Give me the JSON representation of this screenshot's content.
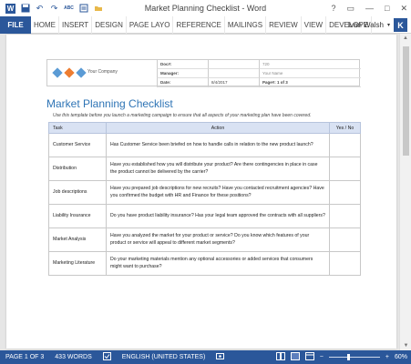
{
  "window": {
    "title": "Market Planning Checklist - Word",
    "controls": [
      "?",
      "▭",
      "—",
      "□",
      "✕"
    ]
  },
  "qat": {
    "icons": [
      "word-icon",
      "save-icon",
      "undo-icon",
      "redo-icon",
      "spelling-icon",
      "print-preview-icon",
      "open-icon"
    ],
    "spelling_label": "ABC"
  },
  "ribbon": {
    "file_label": "FILE",
    "tabs": [
      "HOME",
      "INSERT",
      "DESIGN",
      "PAGE LAYO",
      "REFERENCE",
      "MAILINGS",
      "REVIEW",
      "VIEW",
      "DEVELOPE"
    ],
    "user_name": "Ivan Walsh",
    "avatar_letter": "K",
    "accent": "#2b579a"
  },
  "doc_header": {
    "company": "Your Company",
    "rows": [
      {
        "k1": "Doc#:",
        "v1": "",
        "v2": "720"
      },
      {
        "k1": "Manager:",
        "v1": "",
        "v2": "Your Name"
      },
      {
        "k1": "Date:",
        "v1": "8/4/2017",
        "v2": "Page#: 1 of 3"
      }
    ],
    "diamond_colors": [
      "#5b9bd5",
      "#ed7d31",
      "#5b9bd5"
    ]
  },
  "document": {
    "title": "Market Planning Checklist",
    "intro": "Use this template before you launch a marketing campaign to ensure that all aspects of your marketing plan have been covered.",
    "columns": [
      "Task",
      "Action",
      "Yes / No"
    ],
    "rows": [
      {
        "task": "Customer Service",
        "action": "Has Customer Service been briefed on how to handle calls in relation to the new product launch?",
        "yn": ""
      },
      {
        "task": "Distribution",
        "action": "Have you established how you will distribute your product? Are there contingencies in place in case the product cannot be delivered by the carrier?",
        "yn": ""
      },
      {
        "task": "Job descriptions",
        "action": "Have you prepared job descriptions for new recruits? Have you contacted recruitment agencies? Have you confirmed the budget with HR and Finance for these positions?",
        "yn": ""
      },
      {
        "task": "Liability Insurance",
        "action": "Do you have product liability insurance? Has your legal team approved the contracts with all suppliers?",
        "yn": ""
      },
      {
        "task": "Market Analysis",
        "action": "Have you analyzed the market for your product or service? Do you know which features of your product or service will appeal to different market segments?",
        "yn": ""
      },
      {
        "task": "Marketing Literature",
        "action": "Do your marketing materials mention any optional accessories or added services that consumers might want to purchase?",
        "yn": ""
      }
    ]
  },
  "statusbar": {
    "page": "PAGE 1 OF 3",
    "words": "433 WORDS",
    "language": "ENGLISH (UNITED STATES)",
    "zoom": "60%",
    "zoom_minus": "−",
    "zoom_plus": "+"
  }
}
